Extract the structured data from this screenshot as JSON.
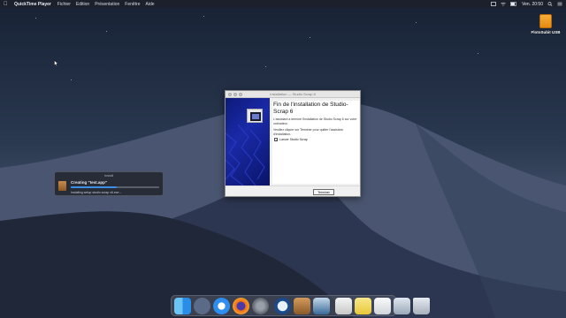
{
  "menubar": {
    "app": "QuickTime Player",
    "items": [
      "Fichier",
      "Edition",
      "Présentation",
      "Fenêtre",
      "Aide"
    ],
    "clock": "Ven. 20:50"
  },
  "desktop": {
    "usb_label": "FlotoSubit USB"
  },
  "install_dialog": {
    "title": "Install",
    "message": "Creating \"test.app\"",
    "progress": 0.52,
    "detail": "Installing setup studio scrap v6.exe..."
  },
  "setup_window": {
    "title": "Installation — Studio Scrap 6",
    "heading": "Fin de l'installation de Studio-Scrap 6",
    "paragraph1": "L'assistant a terminé l'installation de Studio Scrap 6 sur votre ordinateur.",
    "paragraph2": "Veuillez cliquer sur Terminer pour quitter l'assistant d'installation.",
    "checkbox_label": "Lancer Studio Scrap",
    "checkbox_checked": true,
    "finish_button": "Terminer"
  },
  "dock": {
    "icons": [
      "finder-icon",
      "launchpad-icon",
      "safari-icon",
      "firefox-icon",
      "system-preferences-icon",
      "quicktime-icon",
      "installer-icon",
      "archive-utility-icon",
      "preview-icon",
      "notes-icon",
      "mail-icon",
      "downloads-icon",
      "trash-icon"
    ]
  },
  "colors": {
    "setup_sidebar": "#1a2aa8",
    "progress_fill": "#3d8ee6",
    "usb_drive": "#f6b03a"
  }
}
